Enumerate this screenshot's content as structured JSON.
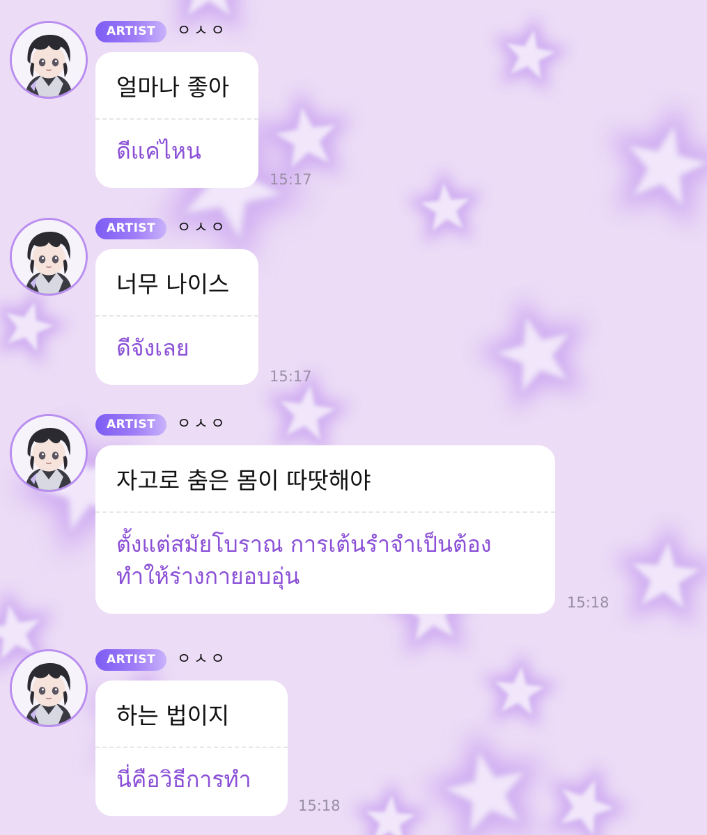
{
  "colors": {
    "background": "#ecdcf6",
    "badge_gradient_start": "#7c5cf4",
    "badge_gradient_end": "#c9b2fa",
    "translation_text": "#8a4fd6",
    "timestamp": "#9a8ea6"
  },
  "messages": [
    {
      "badge": "ARTIST",
      "sender": "ㅇㅅㅇ",
      "original": "얼마나 좋아",
      "translation": "ดีแค่ไหน",
      "time": "15:17",
      "avatar_icon": "artist-avatar-icon"
    },
    {
      "badge": "ARTIST",
      "sender": "ㅇㅅㅇ",
      "original": "너무 나이스",
      "translation": "ดีจังเลย",
      "time": "15:17",
      "avatar_icon": "artist-avatar-icon"
    },
    {
      "badge": "ARTIST",
      "sender": "ㅇㅅㅇ",
      "original": "자고로 춤은 몸이 따땃해야",
      "translation": "ตั้งแต่สมัยโบราณ การเต้นรำจำเป็นต้องทำให้ร่างกายอบอุ่น",
      "time": "15:18",
      "avatar_icon": "artist-avatar-icon"
    },
    {
      "badge": "ARTIST",
      "sender": "ㅇㅅㅇ",
      "original": "하는 법이지",
      "translation": "นี่คือวิธีการทำ",
      "time": "15:18",
      "avatar_icon": "artist-avatar-icon"
    }
  ]
}
